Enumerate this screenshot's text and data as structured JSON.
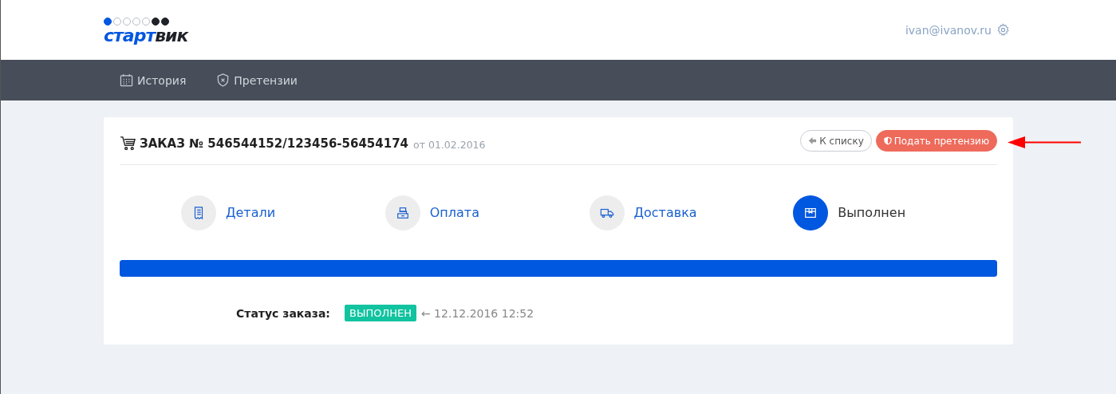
{
  "header": {
    "logo": {
      "dots": [
        {
          "color": "#0057e0",
          "filled": true
        },
        {
          "color": "#b8bcc4",
          "filled": false
        },
        {
          "color": "#b8bcc4",
          "filled": false
        },
        {
          "color": "#b8bcc4",
          "filled": false
        },
        {
          "color": "#b8bcc4",
          "filled": false
        },
        {
          "color": "#1f2228",
          "filled": true
        },
        {
          "color": "#1f2228",
          "filled": true
        }
      ],
      "parts": [
        {
          "text": "старт",
          "color": "#0057e0"
        },
        {
          "text": "вик",
          "color": "#1f2228"
        }
      ]
    },
    "user_email": "ivan@ivanov.ru"
  },
  "nav": [
    {
      "label": "История"
    },
    {
      "label": "Претензии"
    }
  ],
  "order": {
    "title": "ЗАКАЗ № 546544152/123456-56454174",
    "date": "от 01.02.2016",
    "back_button": "К списку",
    "claim_button": "Подать претензию",
    "steps": [
      {
        "label": "Детали",
        "selected": false
      },
      {
        "label": "Оплата",
        "selected": false
      },
      {
        "label": "Доставка",
        "selected": false
      },
      {
        "label": "Выполнен",
        "selected": true
      }
    ],
    "progress": {
      "level": 1
    },
    "status_label": "Статус заказа:",
    "status_badge": "ВЫПОЛНЕН",
    "status_time": "← 12.12.2016 12:52"
  }
}
